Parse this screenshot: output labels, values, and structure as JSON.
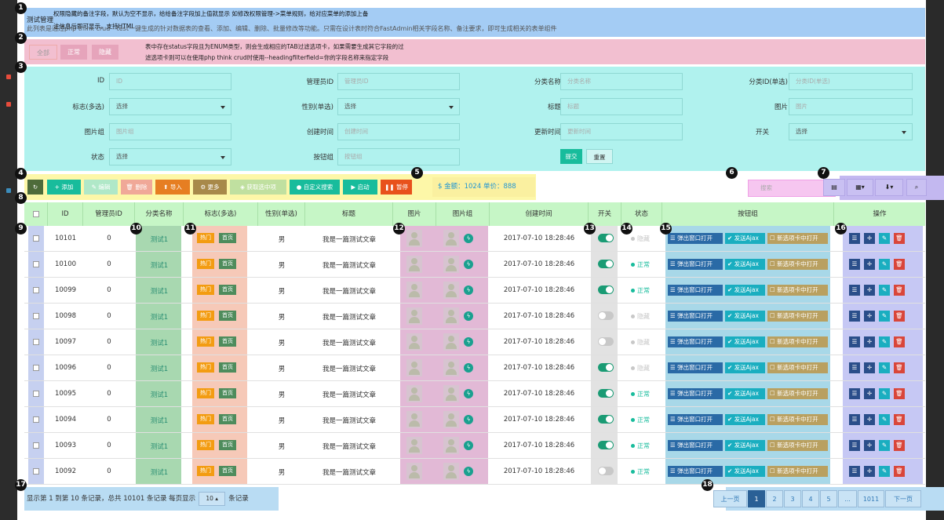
{
  "header": {
    "title": "测试管理",
    "note1": "权限隐藏的备注字段，默认为空不显示，给给备注字段加上值就显示 如修改权限管理->菜单规则，给对应菜单的添加上备",
    "note2": "注信息后即可显示，支持HTML",
    "description": "此列表是通过php think crud --test一键生成的针对数据表的查看、添加、编辑、删除、批量修改等功能。只需在设计表时符合FastAdmin相关字段名称、备注要求，即可生成相关的表单组件"
  },
  "tabs": {
    "items": [
      {
        "label": "全部"
      },
      {
        "label": "正常"
      },
      {
        "label": "隐藏"
      }
    ],
    "note1": "表中存在status字段且为ENUM类型，则会生成相应的TAB过滤选项卡，如果需要生成其它字段的过",
    "note2": "滤选项卡则可以在使用php think crud时使用--headingfilterfield=你的字段名称来指定字段"
  },
  "search_form": {
    "id_label": "ID",
    "id_placeholder": "ID",
    "admin_label": "管理员ID",
    "admin_placeholder": "管理员ID",
    "category_label": "分类名称",
    "category_placeholder": "分类名称",
    "catid_label": "分类ID(单选)",
    "catid_placeholder": "分类ID(单选)",
    "flag_label": "标志(多选)",
    "flag_value": "选择",
    "gender_label": "性别(单选)",
    "gender_value": "选择",
    "title_label": "标题",
    "title_placeholder": "标题",
    "image_label": "图片",
    "image_placeholder": "图片",
    "images_label": "图片组",
    "images_placeholder": "图片组",
    "created_label": "创建时间",
    "created_placeholder": "创建时间",
    "updated_label": "更新时间",
    "updated_placeholder": "更新时间",
    "switch_label": "开关",
    "switch_value": "选择",
    "status_label": "状态",
    "status_value": "选择",
    "btngroup_label": "按钮组",
    "btngroup_placeholder": "按钮组",
    "submit_label": "提交",
    "reset_label": "重置"
  },
  "toolbar": {
    "refresh_icon": "refresh-icon",
    "add_label": "+ 添加",
    "edit_label": "✎ 编辑",
    "delete_label": "🗑 删除",
    "import_label": "⬆ 导入",
    "more_label": "⚙ 更多",
    "getselected_label": "◈ 获取选中项",
    "customsearch_label": "● 自定义搜索",
    "start_label": "▶ 启动",
    "pause_label": "❚❚ 暂停",
    "summary": "$ 金额：1024 单价：888",
    "search_placeholder": "搜索",
    "colors": {
      "green": "#18bc9c",
      "blue": "#3c8dbc",
      "orange": "#f39c12",
      "red": "#e74c3c"
    }
  },
  "table": {
    "headers": [
      "ID",
      "管理员ID",
      "分类名称",
      "标志(多选)",
      "性别(单选)",
      "标题",
      "图片",
      "图片组",
      "创建时间",
      "开关",
      "状态",
      "按钮组",
      "操作"
    ],
    "flag_hot": "热门",
    "flag_index": "首页",
    "btn_popup": "☰ 弹出窗口打开",
    "btn_ajax": "✔ 发送Ajax",
    "btn_newtab": "☐ 新选项卡中打开",
    "rows": [
      {
        "id": "10101",
        "admin": "0",
        "category": "测试1",
        "gender": "男",
        "title": "我是一篇测试文章",
        "time": "2017-07-10 18:28:46",
        "switch": true,
        "status": "隐藏"
      },
      {
        "id": "10100",
        "admin": "0",
        "category": "测试1",
        "gender": "男",
        "title": "我是一篇测试文章",
        "time": "2017-07-10 18:28:46",
        "switch": true,
        "status": "正常"
      },
      {
        "id": "10099",
        "admin": "0",
        "category": "测试1",
        "gender": "男",
        "title": "我是一篇测试文章",
        "time": "2017-07-10 18:28:46",
        "switch": true,
        "status": "正常"
      },
      {
        "id": "10098",
        "admin": "0",
        "category": "测试1",
        "gender": "男",
        "title": "我是一篇测试文章",
        "time": "2017-07-10 18:28:46",
        "switch": false,
        "status": "隐藏"
      },
      {
        "id": "10097",
        "admin": "0",
        "category": "测试1",
        "gender": "男",
        "title": "我是一篇测试文章",
        "time": "2017-07-10 18:28:46",
        "switch": false,
        "status": "隐藏"
      },
      {
        "id": "10096",
        "admin": "0",
        "category": "测试1",
        "gender": "男",
        "title": "我是一篇测试文章",
        "time": "2017-07-10 18:28:46",
        "switch": true,
        "status": "隐藏"
      },
      {
        "id": "10095",
        "admin": "0",
        "category": "测试1",
        "gender": "男",
        "title": "我是一篇测试文章",
        "time": "2017-07-10 18:28:46",
        "switch": true,
        "status": "正常"
      },
      {
        "id": "10094",
        "admin": "0",
        "category": "测试1",
        "gender": "男",
        "title": "我是一篇测试文章",
        "time": "2017-07-10 18:28:46",
        "switch": true,
        "status": "正常"
      },
      {
        "id": "10093",
        "admin": "0",
        "category": "测试1",
        "gender": "男",
        "title": "我是一篇测试文章",
        "time": "2017-07-10 18:28:46",
        "switch": true,
        "status": "正常"
      },
      {
        "id": "10092",
        "admin": "0",
        "category": "测试1",
        "gender": "男",
        "title": "我是一篇测试文章",
        "time": "2017-07-10 18:28:46",
        "switch": false,
        "status": "正常"
      }
    ]
  },
  "footer": {
    "summary_prefix": "显示第 1 到第 10 条记录，总共 10101 条记录 每页显示",
    "page_size": "10 ▴",
    "summary_suffix": "条记录"
  },
  "pagination": {
    "prev": "上一页",
    "pages": [
      "1",
      "2",
      "3",
      "4",
      "5",
      "...",
      "1011"
    ],
    "next": "下一页"
  },
  "badges": [
    "1",
    "2",
    "3",
    "4",
    "5",
    "6",
    "7",
    "8",
    "9",
    "10",
    "11",
    "12",
    "13",
    "14",
    "15",
    "16",
    "17",
    "18"
  ]
}
